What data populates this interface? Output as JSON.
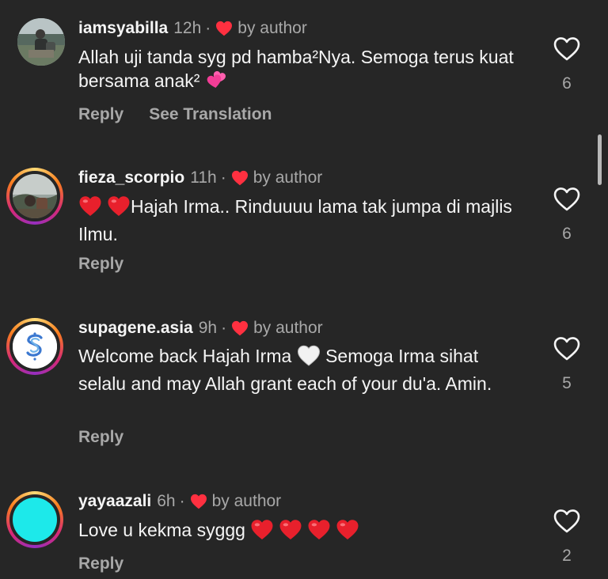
{
  "colors": {
    "background": "#262626",
    "primary_text": "#f5f5f5",
    "secondary_text": "#a8a8a8",
    "heart_red": "#ff3040",
    "story_ring": "#d62976"
  },
  "comments": [
    {
      "username": "iamsyabilla",
      "time": "12h",
      "dot": "·",
      "by_author": "by author",
      "text": "Allah uji tanda syg pd hamba²Nya. Semoga terus kuat bersama anak²",
      "emoji_after": "two-hearts-emoji",
      "reply_label": "Reply",
      "translation_label": "See Translation",
      "likes": "6",
      "avatar": "photo-avatar"
    },
    {
      "username": "fieza_scorpio",
      "time": "11h",
      "dot": "·",
      "by_author": "by author",
      "emoji_before": [
        "red-heart-emoji",
        "red-heart-emoji"
      ],
      "text": "Hajah Irma.. Rinduuuu lama tak jumpa di majlis Ilmu.",
      "reply_label": "Reply",
      "likes": "6",
      "avatar": "photo-avatar-story-ring"
    },
    {
      "username": "supagene.asia",
      "time": "9h",
      "dot": "·",
      "by_author": "by author",
      "text_before": "Welcome back Hajah Irma",
      "emoji_mid": "white-heart-emoji",
      "text_after": "Semoga Irma sihat selalu and may Allah grant each of your du'a. Amin.",
      "reply_label": "Reply",
      "likes": "5",
      "avatar": "logo-avatar-story-ring"
    },
    {
      "username": "yayaazali",
      "time": "6h",
      "dot": "·",
      "by_author": "by author",
      "text": "Love u kekma syggg",
      "emoji_after": [
        "red-heart-emoji",
        "red-heart-emoji",
        "red-heart-emoji",
        "red-heart-emoji"
      ],
      "reply_label": "Reply",
      "likes": "2",
      "avatar": "cyan-avatar-story-ring"
    }
  ]
}
